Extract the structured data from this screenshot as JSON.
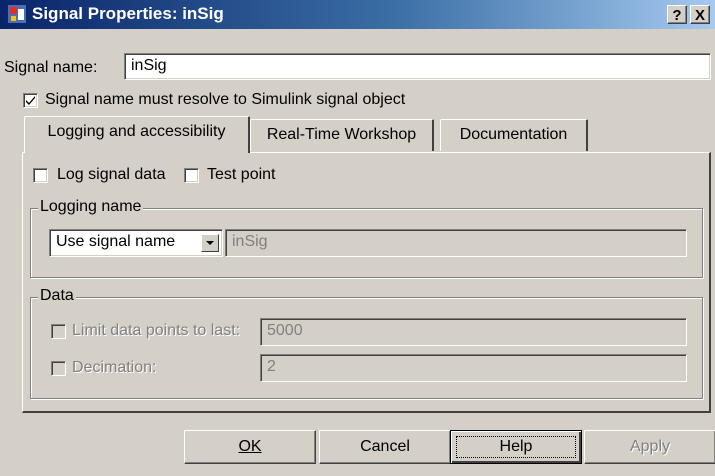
{
  "window": {
    "title": "Signal Properties: inSig",
    "help_glyph": "?",
    "close_glyph": "X"
  },
  "signal_name": {
    "label": "Signal name:",
    "value": "inSig"
  },
  "resolve_checkbox": {
    "label": "Signal name must resolve to Simulink signal object",
    "checked": true
  },
  "tabs": [
    {
      "label": "Logging and accessibility",
      "active": true
    },
    {
      "label": "Real-Time Workshop",
      "active": false
    },
    {
      "label": "Documentation",
      "active": false
    }
  ],
  "logging": {
    "log_signal_data_label": "Log signal data",
    "log_signal_data_checked": false,
    "test_point_label": "Test point",
    "test_point_checked": false,
    "logging_name_group": "Logging name",
    "logging_name_mode": "Use signal name",
    "logging_name_value": "inSig"
  },
  "data": {
    "group_title": "Data",
    "limit_label": "Limit data points to last:",
    "limit_value": "5000",
    "decimation_label": "Decimation:",
    "decimation_value": "2"
  },
  "buttons": {
    "ok": "OK",
    "cancel": "Cancel",
    "help": "Help",
    "apply": "Apply"
  },
  "icons": [
    "simulink-app-icon",
    "help-caption-icon",
    "close-icon",
    "checkmark-icon",
    "dropdown-arrow-icon"
  ]
}
